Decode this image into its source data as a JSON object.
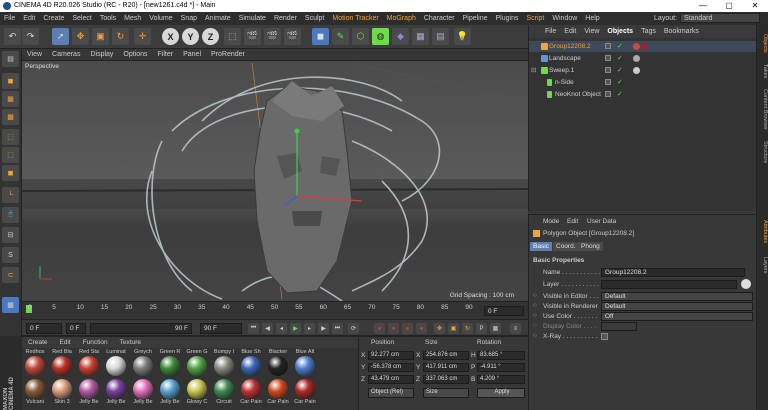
{
  "window": {
    "title": "CINEMA 4D R20.026 Studio (RC - R20) - [new1261.c4d *] - Main",
    "controls": [
      "—",
      "▢",
      "✕"
    ]
  },
  "menubar": {
    "items": [
      "File",
      "Edit",
      "Create",
      "Select",
      "Tools",
      "Mesh",
      "Volume",
      "Snap",
      "Animate",
      "Simulate",
      "Render",
      "Sculpt",
      "Motion Tracker",
      "MoGraph",
      "Character",
      "Pipeline",
      "Plugins",
      "Script",
      "Window",
      "Help"
    ],
    "layout_label": "Layout:",
    "layout_value": "Standard"
  },
  "toolbar": {
    "axis_buttons": [
      "X",
      "Y",
      "Z"
    ]
  },
  "viewport": {
    "menu": [
      "View",
      "Cameras",
      "Display",
      "Options",
      "Filter",
      "Panel",
      "ProRender"
    ],
    "camera_label": "Perspective",
    "grid_spacing": "Grid Spacing : 100 cm"
  },
  "timeline": {
    "ticks": [
      "0",
      "5",
      "10",
      "15",
      "20",
      "25",
      "30",
      "35",
      "40",
      "45",
      "50",
      "55",
      "60",
      "65",
      "70",
      "75",
      "80",
      "85",
      "90"
    ],
    "end_frame": "0 F"
  },
  "playbar": {
    "current_frame": "0 F",
    "start_frame": "0 F",
    "end_display": "90 F",
    "end_frame": "90 F"
  },
  "materials": {
    "menu": [
      "Create",
      "Edit",
      "Function",
      "Texture"
    ],
    "row1": [
      {
        "label": "Redhos",
        "color": "#c04a3a"
      },
      {
        "label": "Red Bla",
        "color": "#b83228"
      },
      {
        "label": "Red Sta",
        "color": "#c8402e"
      },
      {
        "label": "Luminat",
        "color": "#d9d9d9"
      },
      {
        "label": "Greych",
        "color": "#7d7d7d"
      },
      {
        "label": "Green R",
        "color": "#3f8a3a"
      },
      {
        "label": "Green G",
        "color": "#52a345"
      },
      {
        "label": "Bumpy I",
        "color": "#8a8a80"
      },
      {
        "label": "Blue Sh",
        "color": "#3a66b8"
      },
      {
        "label": "Blacker",
        "color": "#222222"
      },
      {
        "label": "Blue Alt",
        "color": "#4d7ed0"
      }
    ],
    "row2": [
      {
        "label": "Vulcani",
        "color": "#8a5a3a"
      },
      {
        "label": "Skin 3",
        "color": "#d99a7a"
      },
      {
        "label": "Jelly Be",
        "color": "#b05aa0"
      },
      {
        "label": "Jelly Be",
        "color": "#7a3fa0"
      },
      {
        "label": "Jelly Be",
        "color": "#e070b8"
      },
      {
        "label": "Jelly Be",
        "color": "#5aa0d0"
      },
      {
        "label": "Glowy C",
        "color": "#c8c850"
      },
      {
        "label": "Circuit",
        "color": "#3f8a50"
      },
      {
        "label": "Car Pain",
        "color": "#c03030"
      },
      {
        "label": "Car Pain",
        "color": "#d04a20"
      },
      {
        "label": "Car Pain",
        "color": "#b02828"
      }
    ]
  },
  "coordinates": {
    "headers": [
      "Position",
      "Size",
      "Rotation"
    ],
    "rows": [
      {
        "axis": "X",
        "pos": "92.277 cm",
        "size": "254.876 cm",
        "rot_label": "H",
        "rot": "83.685 °"
      },
      {
        "axis": "Y",
        "pos": "-56.378 cm",
        "size": "417.911 cm",
        "rot_label": "P",
        "rot": "-4.911 °"
      },
      {
        "axis": "Z",
        "pos": "43.479 cm",
        "size": "337.063 cm",
        "rot_label": "B",
        "rot": "4.209 °"
      }
    ],
    "mode": "Object (Rel)",
    "size_mode": "Size",
    "apply": "Apply"
  },
  "objects": {
    "menu": [
      "File",
      "Edit",
      "View",
      "Objects",
      "Tags",
      "Bookmarks"
    ],
    "items": [
      {
        "name": "Group12208.2",
        "selected": true,
        "color": "#f2a33a"
      },
      {
        "name": "Landscape",
        "selected": false,
        "color": "#5a9ad0"
      },
      {
        "name": "Sweep.1",
        "selected": false,
        "color": "#6ddc4c"
      },
      {
        "name": "n-Side",
        "selected": false,
        "color": "#6ddc4c"
      },
      {
        "name": "NeoKnot Object",
        "selected": false,
        "color": "#6ddc4c"
      }
    ]
  },
  "attributes": {
    "menu": [
      "Mode",
      "Edit",
      "User Data"
    ],
    "object_title": "Polygon Object [Group12208.2]",
    "tabs": [
      "Basic",
      "Coord.",
      "Phong"
    ],
    "section": "Basic Properties",
    "fields": [
      {
        "label": "Name . . . . . . . . . . .",
        "value": "Group12208.2"
      },
      {
        "label": "Layer . . . . . . . . . . .",
        "value": ""
      },
      {
        "label": "Visible in Editor . . .",
        "value": "Default"
      },
      {
        "label": "Visible in Renderer",
        "value": "Default"
      },
      {
        "label": "Use Color . . . . . . .",
        "value": "Off"
      },
      {
        "label": "Display Color . . . .",
        "value": ""
      },
      {
        "label": "X-Ray . . . . . . . . . .",
        "value": ""
      }
    ]
  },
  "right_strip": [
    "Objects",
    "Takes",
    "Content Browser",
    "Structure",
    "Attributes",
    "Layers"
  ],
  "brand": "MAXON CINEMA 4D"
}
